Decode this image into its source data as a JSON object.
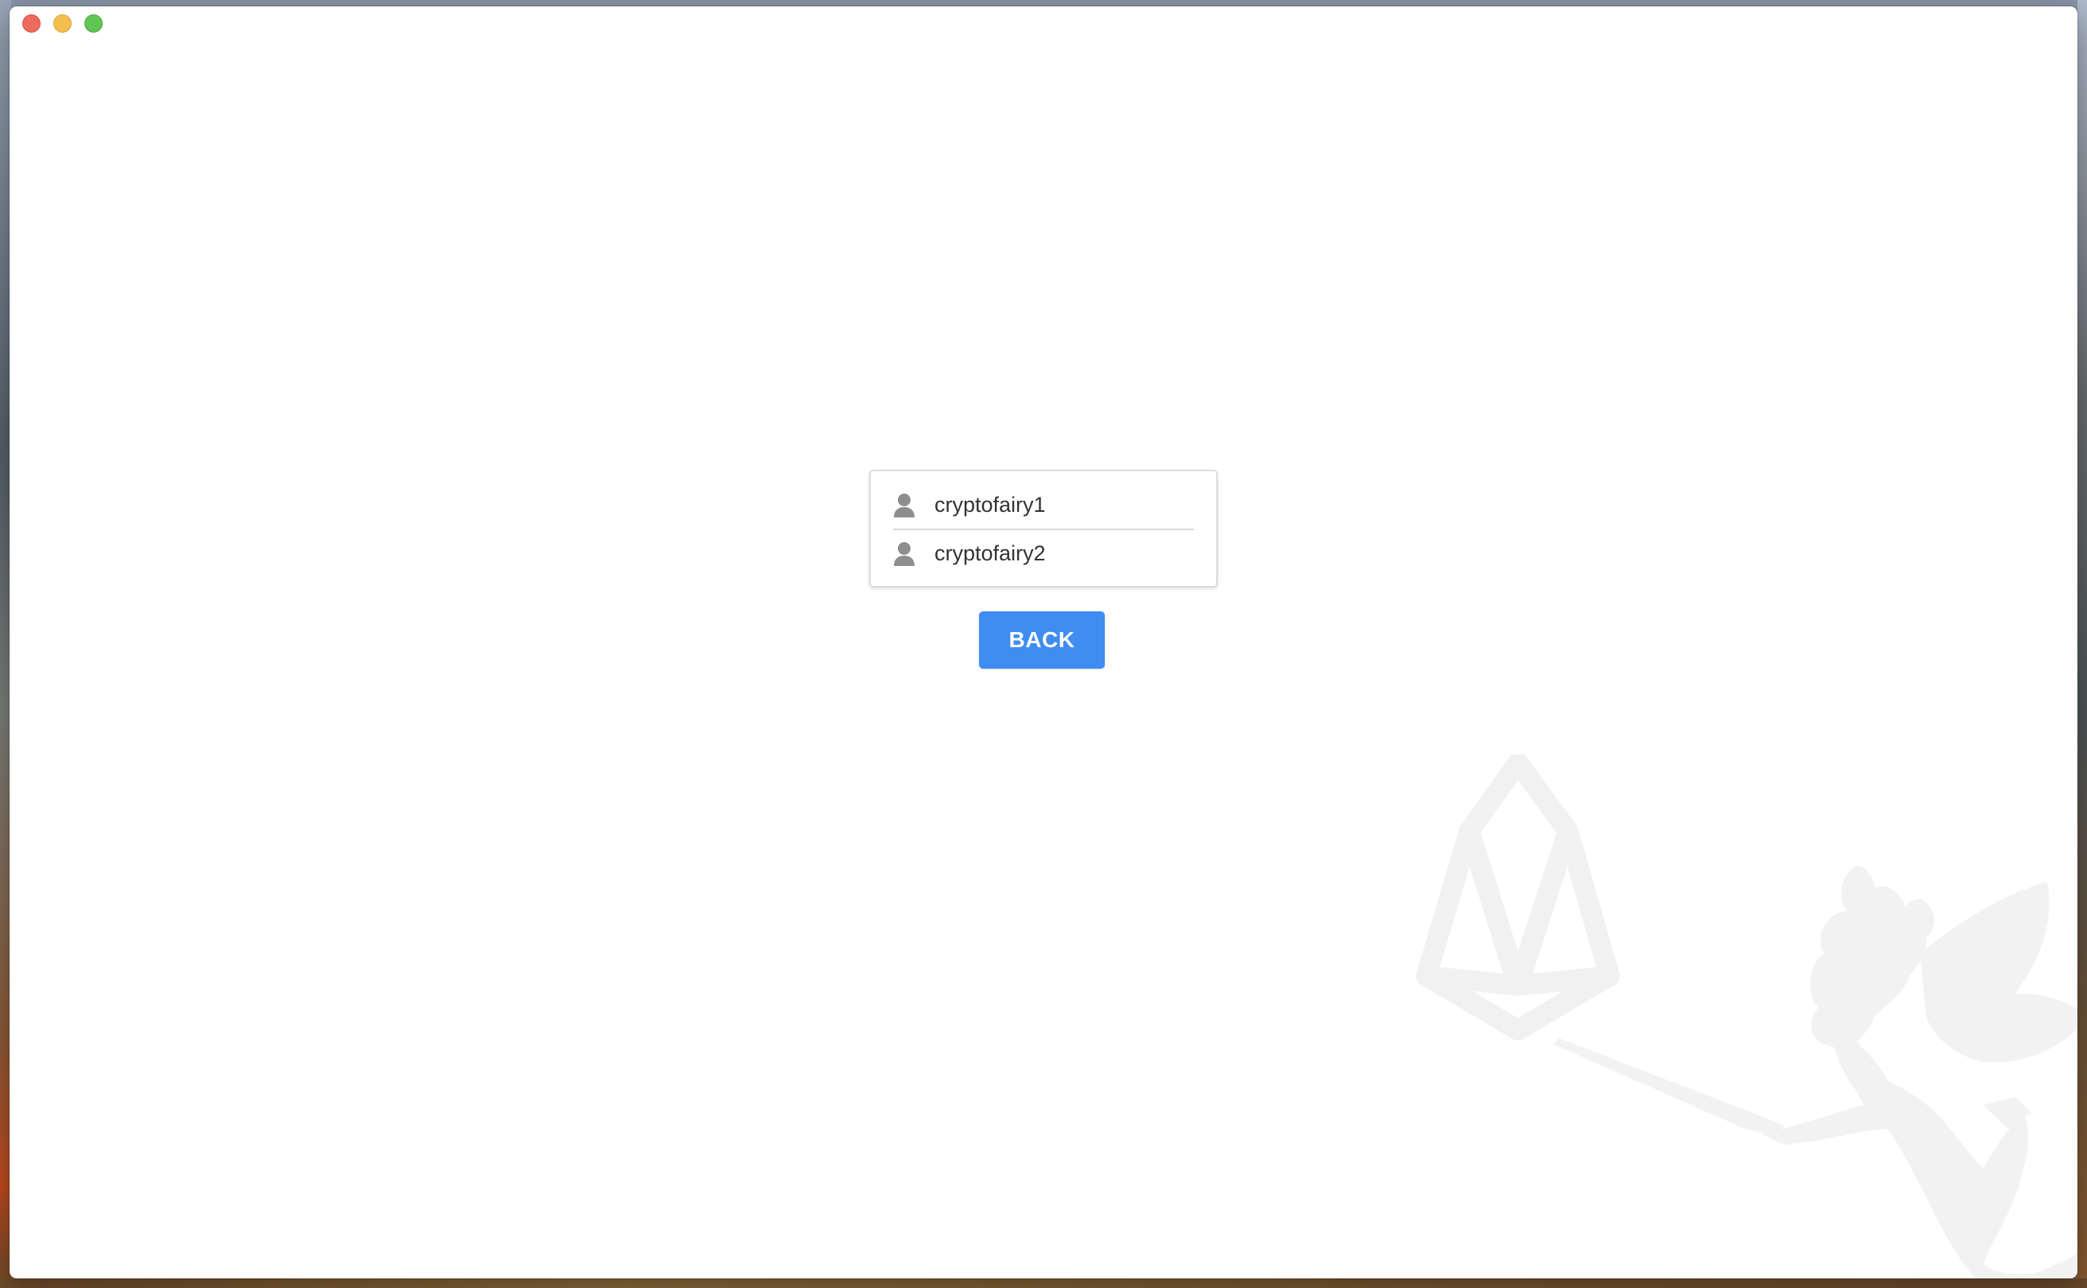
{
  "window": {
    "controls": {
      "close": "close-control",
      "minimize": "minimize-control",
      "zoom": "zoom-control"
    }
  },
  "accounts": [
    {
      "name": "cryptofairy1",
      "icon": "user-icon"
    },
    {
      "name": "cryptofairy2",
      "icon": "user-icon"
    }
  ],
  "actions": {
    "back_label": "BACK"
  },
  "colors": {
    "accent": "#3f8df0",
    "icon_gray": "#8e8e8e",
    "text": "#333333",
    "watermark": "#f2f2f2"
  },
  "watermark": {
    "description_icon": "eos-fairy-watermark-icon"
  }
}
